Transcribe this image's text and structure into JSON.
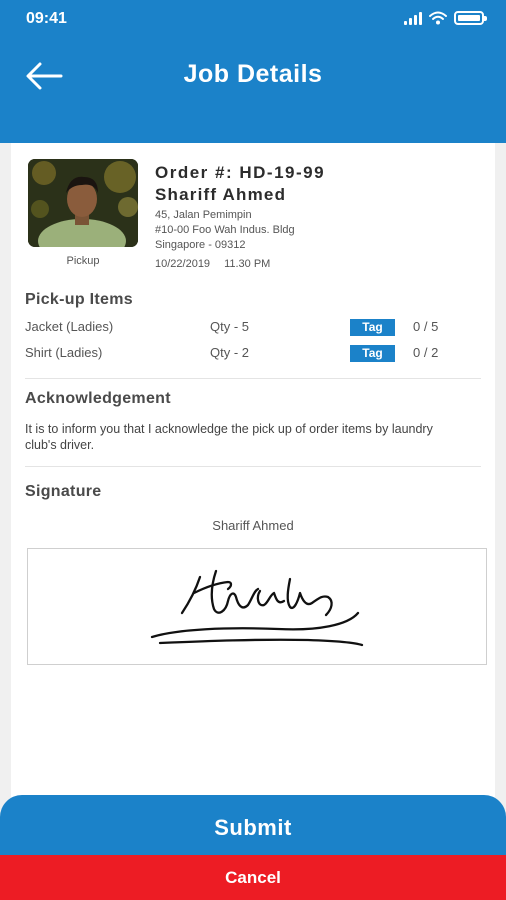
{
  "status_bar": {
    "time": "09:41",
    "icons": [
      "signal-icon",
      "wifi-icon",
      "battery-icon"
    ]
  },
  "header": {
    "title": "Job Details",
    "back_icon": "arrow-left-icon"
  },
  "order": {
    "number": "Order #: HD-19-99",
    "customer": "Shariff Ahmed",
    "address": [
      "45, Jalan Pemimpin",
      "#10-00 Foo Wah Indus. Bldg",
      "Singapore - 09312"
    ],
    "date": "10/22/2019",
    "time": "11.30 PM",
    "photo_caption": "Pickup"
  },
  "pickup": {
    "title": "Pick-up Items",
    "items": [
      {
        "name": "Jacket (Ladies)",
        "qty": "Qty - 5",
        "tag_label": "Tag",
        "count": "0 / 5"
      },
      {
        "name": "Shirt (Ladies)",
        "qty": "Qty - 2",
        "tag_label": "Tag",
        "count": "0 / 2"
      }
    ]
  },
  "acknowledgement": {
    "title": "Acknowledgement",
    "text": "It is to inform you that I acknowledge the pick up of order items by laundry club's driver."
  },
  "signature": {
    "title": "Signature",
    "name": "Shariff Ahmed"
  },
  "actions": {
    "submit": "Submit",
    "cancel": "Cancel"
  },
  "colors": {
    "primary": "#1b82c9",
    "danger": "#ed1c24",
    "background": "#f0f0f0"
  }
}
